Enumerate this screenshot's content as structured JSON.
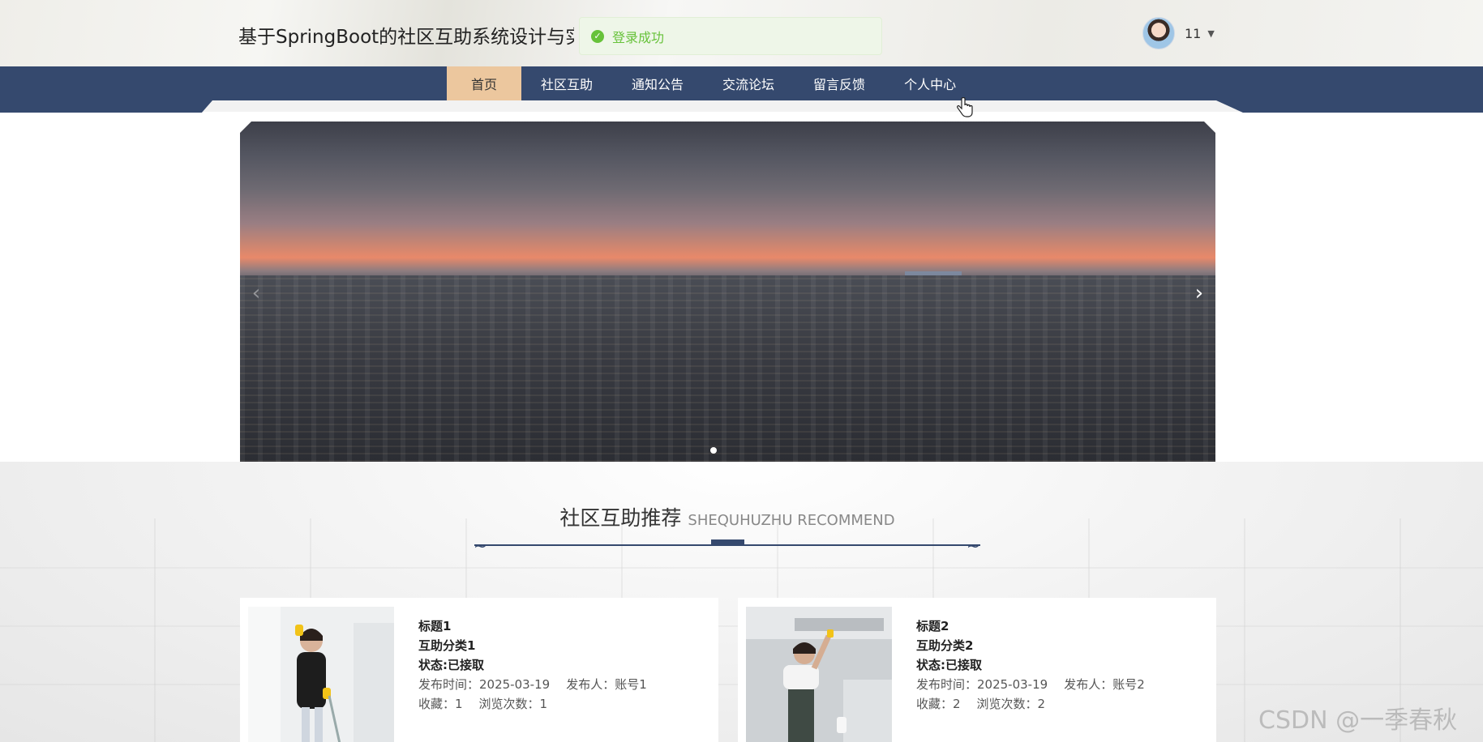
{
  "header": {
    "site_title": "基于SpringBoot的社区互助系统设计与实现",
    "toast": "登录成功",
    "user_name": "11"
  },
  "nav": {
    "items": [
      {
        "label": "首页",
        "active": true
      },
      {
        "label": "社区互助"
      },
      {
        "label": "通知公告"
      },
      {
        "label": "交流论坛"
      },
      {
        "label": "留言反馈"
      },
      {
        "label": "个人中心"
      }
    ]
  },
  "banner": {
    "prev_arrow": "‹",
    "next_arrow": "›",
    "slide_count": 1
  },
  "section": {
    "title_cn": "社区互助推荐",
    "title_en": "SHEQUHUZHU RECOMMEND"
  },
  "cards": [
    {
      "title": "标题1",
      "category": "互助分类1",
      "status": "状态:已接取",
      "publish_time": "发布时间：2025-03-19",
      "publisher": "发布人：账号1",
      "favorites": "收藏：1",
      "views": "浏览次数：1"
    },
    {
      "title": "标题2",
      "category": "互助分类2",
      "status": "状态:已接取",
      "publish_time": "发布时间：2025-03-19",
      "publisher": "发布人：账号2",
      "favorites": "收藏：2",
      "views": "浏览次数：2"
    }
  ],
  "watermark": "CSDN @一季春秋",
  "colors": {
    "nav_bg": "#35496e",
    "nav_active": "#ecc79e",
    "toast_green": "#67c23a"
  }
}
